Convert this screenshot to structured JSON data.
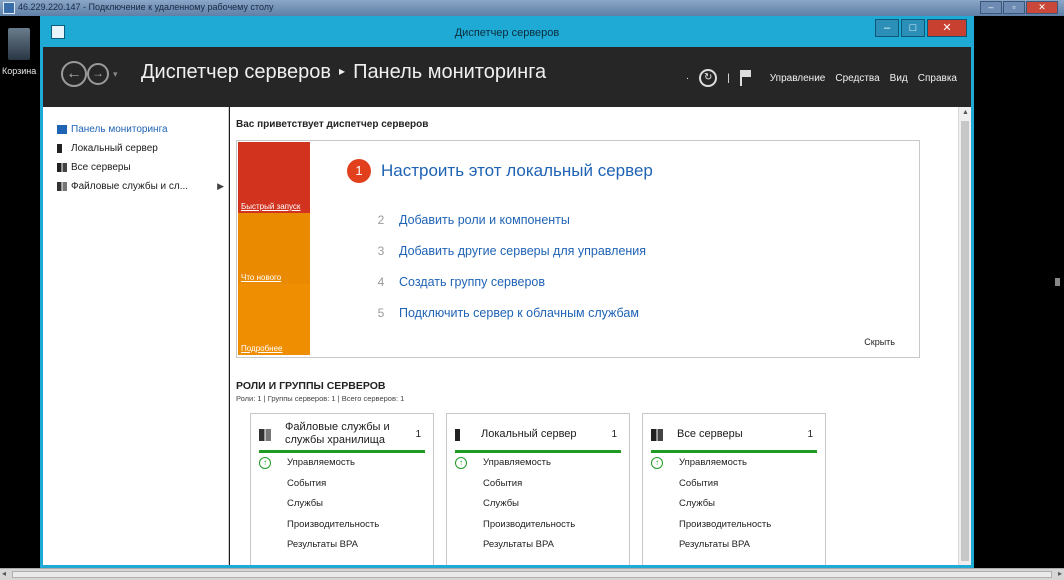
{
  "rdp": {
    "title": "46.229.220.147 - Подключение к удаленному рабочему столу"
  },
  "desktop": {
    "recycle_label": "Корзина"
  },
  "window": {
    "title": "Диспетчер серверов",
    "accent": "#1faad6"
  },
  "header": {
    "breadcrumb_app": "Диспетчер серверов",
    "breadcrumb_sep": "▸",
    "breadcrumb_page": "Панель мониторинга",
    "menu": [
      "Управление",
      "Средства",
      "Вид",
      "Справка"
    ]
  },
  "sidebar": {
    "items": [
      {
        "label": "Панель мониторинга",
        "icon": "dashboard-icon",
        "active": true
      },
      {
        "label": "Локальный сервер",
        "icon": "server-icon"
      },
      {
        "label": "Все серверы",
        "icon": "servers-icon"
      },
      {
        "label": "Файловые службы и сл...",
        "icon": "file-services-icon",
        "arrow": "▶"
      }
    ]
  },
  "main": {
    "welcome": "Вас приветствует диспетчер серверов",
    "tiles": [
      "Быстрый запуск",
      "Что нового",
      "Подробнее"
    ],
    "step1": {
      "num": "1",
      "label": "Настроить этот локальный сервер"
    },
    "steps": [
      {
        "num": "2",
        "label": "Добавить роли и компоненты"
      },
      {
        "num": "3",
        "label": "Добавить другие серверы для управления"
      },
      {
        "num": "4",
        "label": "Создать группу серверов"
      },
      {
        "num": "5",
        "label": "Подключить сервер к облачным службам"
      }
    ],
    "hide": "Скрыть",
    "roles_title": "РОЛИ И ГРУППЫ СЕРВЕРОВ",
    "roles_sub": "Роли: 1 | Группы серверов: 1 | Всего серверов: 1",
    "cards": [
      {
        "name": "Файловые службы и службы хранилища",
        "count": "1",
        "icon": "file-services-icon",
        "rows": [
          "Управляемость",
          "События",
          "Службы",
          "Производительность",
          "Результаты BPA"
        ]
      },
      {
        "name": "Локальный сервер",
        "count": "1",
        "icon": "server-icon",
        "rows": [
          "Управляемость",
          "События",
          "Службы",
          "Производительность",
          "Результаты BPA"
        ]
      },
      {
        "name": "Все серверы",
        "count": "1",
        "icon": "servers-icon",
        "rows": [
          "Управляемость",
          "События",
          "Службы",
          "Производительность",
          "Результаты BPA"
        ]
      }
    ]
  },
  "colors": {
    "tile_red": "#d2331f",
    "tile_orange": "#e98a00",
    "link_blue": "#1f63b5",
    "status_green": "#1f9b24"
  }
}
